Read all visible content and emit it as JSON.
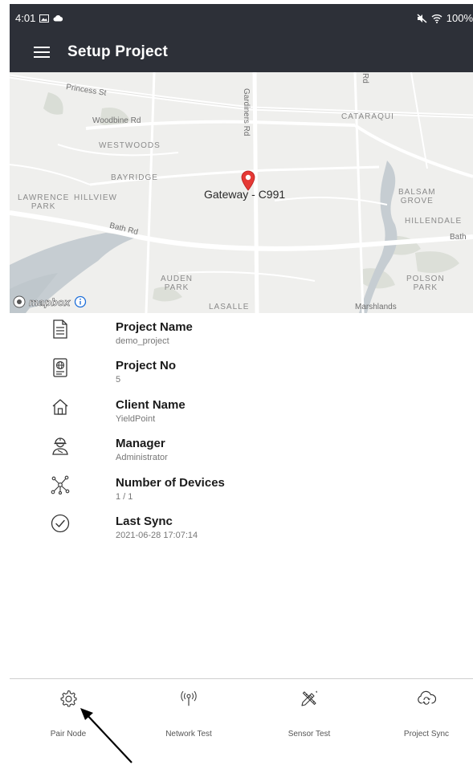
{
  "status_bar": {
    "time": "4:01",
    "battery": "100%",
    "icons": [
      "image-icon",
      "cloud-icon",
      "mute-icon",
      "wifi-icon"
    ]
  },
  "app_bar": {
    "title": "Setup Project",
    "menu_icon": "menu-icon"
  },
  "map": {
    "marker_label": "Gateway - C991",
    "attribution": "mapbox",
    "labels": {
      "princess_st": "Princess St",
      "gardiners_rd": "Gardiners Rd",
      "rd_top": "Rd",
      "woodbine_rd": "Woodbine Rd",
      "cataraqui": "CATARAQUI",
      "westwoods": "WESTWOODS",
      "bayridge": "BAYRIDGE",
      "lawrence_park": "LAWRENCE\nPARK",
      "hillview": "HILLVIEW",
      "balsam_grove": "BALSAM\nGROVE",
      "hillendale": "HILLENDALE",
      "bath_rd_left": "Bath Rd",
      "bath_right": "Bath",
      "auden_park": "AUDEN\nPARK",
      "polson_park": "POLSON\nPARK",
      "lasalle": "LASALLE",
      "marshlands": "Marshlands"
    }
  },
  "details": [
    {
      "icon": "document-icon",
      "title": "Project Name",
      "value": "demo_project"
    },
    {
      "icon": "globe-document-icon",
      "title": "Project No",
      "value": "5"
    },
    {
      "icon": "home-icon",
      "title": "Client Name",
      "value": "YieldPoint"
    },
    {
      "icon": "worker-icon",
      "title": "Manager",
      "value": "Administrator"
    },
    {
      "icon": "network-icon",
      "title": "Number of Devices",
      "value": "1 / 1"
    },
    {
      "icon": "check-circle-icon",
      "title": "Last Sync",
      "value": "2021-06-28 17:07:14"
    }
  ],
  "bottom_nav": [
    {
      "icon": "gear-icon",
      "label": "Pair Node"
    },
    {
      "icon": "antenna-icon",
      "label": "Network Test"
    },
    {
      "icon": "tools-icon",
      "label": "Sensor Test"
    },
    {
      "icon": "cloud-sync-icon",
      "label": "Project Sync"
    }
  ],
  "colors": {
    "app_bar": "#2d3038",
    "map_background": "#efefed",
    "marker": "#e53935",
    "text_primary": "#1b1b1b",
    "text_secondary": "#777777"
  }
}
